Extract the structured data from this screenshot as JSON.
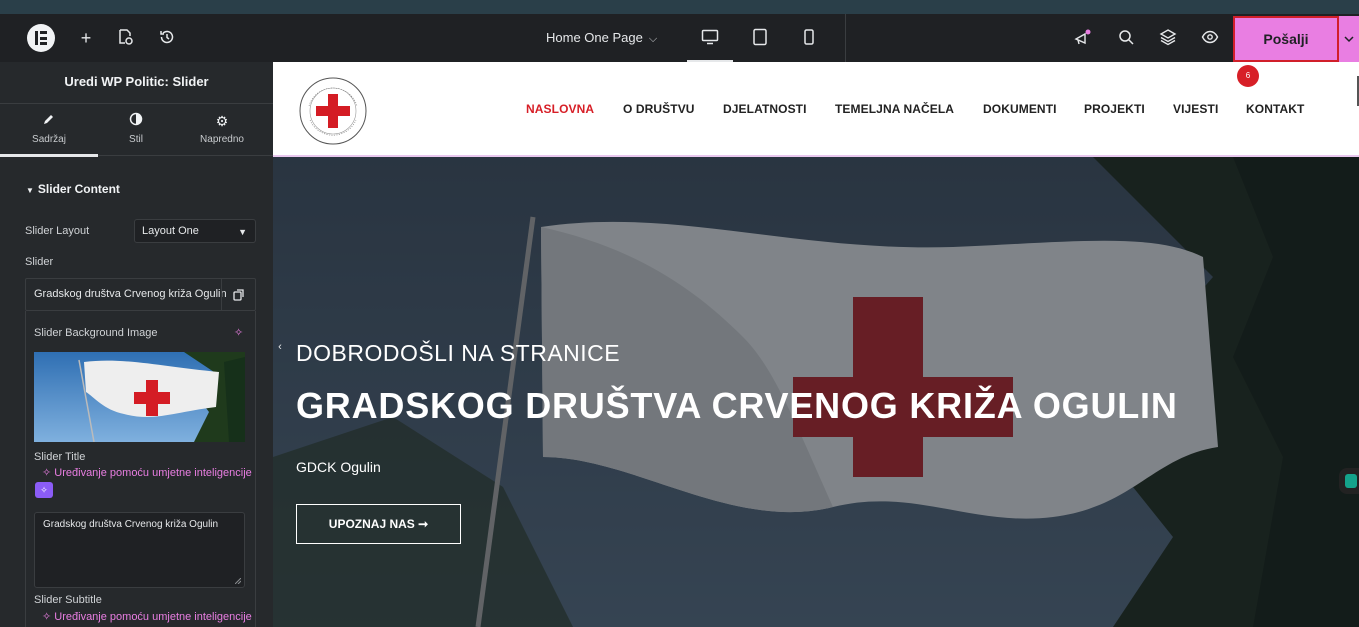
{
  "topbar": {
    "page_name": "Home One Page",
    "publish_label": "Pošalji",
    "notification_count": "6",
    "icons": [
      "elementor-logo-icon",
      "add-icon",
      "structure-icon",
      "history-icon",
      "desktop-icon",
      "tablet-icon",
      "mobile-icon",
      "whats-new-icon",
      "search-icon",
      "layers-icon",
      "preview-icon",
      "chevron-down-icon"
    ],
    "accent_color": "#e97ee2"
  },
  "panel": {
    "title": "Uredi WP Politic: Slider",
    "tabs": [
      {
        "label": "Sadržaj"
      },
      {
        "label": "Stil"
      },
      {
        "label": "Napredno"
      }
    ],
    "section_title": "Slider Content",
    "layout_label": "Slider Layout",
    "layout_value": "Layout One",
    "slider_label": "Slider",
    "item_title": "Gradskog društva Crvenog križa Ogulin",
    "bg_label": "Slider Background Image",
    "title_label": "Slider Title",
    "ai_label": "Uređivanje pomoću umjetne inteligencije",
    "title_value": "Gradskog društva Crvenog križa Ogulin",
    "subtitle_label": "Slider Subtitle",
    "ai_label_2": "Uređivanje pomoću umjetne inteligencije"
  },
  "site": {
    "nav": [
      "NASLOVNA",
      "O DRUŠTVU",
      "DJELATNOSTI",
      "TEMELJNA NAČELA",
      "DOKUMENTI",
      "PROJEKTI",
      "VIJESTI",
      "KONTAKT"
    ],
    "logo_text": "HRVATSKI CRVENI KRIŽ · GRADSKO DRUŠTVO CRVENOG KRIŽA OGULIN",
    "hero": {
      "welcome": "DOBRODOŠLI NA STRANICE",
      "title": "GRADSKOG DRUŠTVA CRVENOG KRIŽA OGULIN",
      "subtitle": "GDCK Ogulin",
      "button": "UPOZNAJ NAS ➞"
    },
    "brand_red": "#d71f27"
  }
}
